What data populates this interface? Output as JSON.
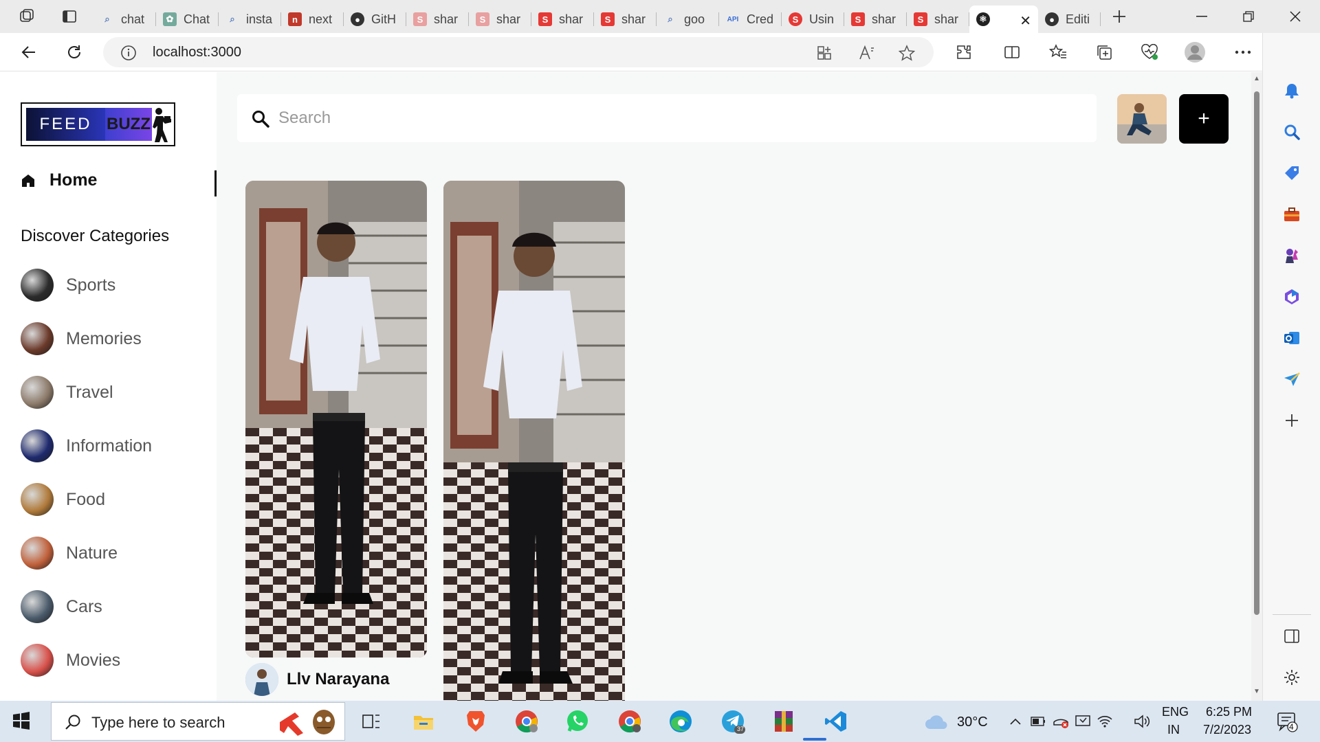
{
  "browser": {
    "tabs": [
      {
        "title": "chat",
        "favicon": "search-favicon",
        "color": "#5b7fbf"
      },
      {
        "title": "Chat",
        "favicon": "openai-favicon",
        "color": "#74aa9c"
      },
      {
        "title": "insta",
        "favicon": "search-favicon",
        "color": "#5b7fbf"
      },
      {
        "title": "next",
        "favicon": "n-favicon",
        "color": "#c0392b"
      },
      {
        "title": "GitH",
        "favicon": "github-favicon",
        "color": "#333333"
      },
      {
        "title": "shar",
        "favicon": "s-favicon",
        "color": "#e8a0a0"
      },
      {
        "title": "shar",
        "favicon": "s-favicon",
        "color": "#e8a0a0"
      },
      {
        "title": "shar",
        "favicon": "s-favicon",
        "color": "#e53935"
      },
      {
        "title": "shar",
        "favicon": "s-favicon",
        "color": "#e53935"
      },
      {
        "title": "goo",
        "favicon": "search-favicon",
        "color": "#5b7fbf"
      },
      {
        "title": "Cred",
        "favicon": "api-favicon",
        "color": "#3b6fd6"
      },
      {
        "title": "Usin",
        "favicon": "s-circle-favicon",
        "color": "#e53935"
      },
      {
        "title": "shar",
        "favicon": "s-favicon",
        "color": "#e53935"
      },
      {
        "title": "shar",
        "favicon": "s-favicon",
        "color": "#e53935"
      },
      {
        "title": "",
        "favicon": "react-favicon",
        "color": "#222222",
        "active": true
      },
      {
        "title": "Editi",
        "favicon": "github-favicon",
        "color": "#333333"
      }
    ],
    "url": "localhost:3000"
  },
  "sidebar": {
    "logo_left": "FEED",
    "logo_right": "BUZZ",
    "home_label": "Home",
    "discover_heading": "Discover Categories",
    "categories": [
      {
        "label": "Sports",
        "color": "#2b2b2b"
      },
      {
        "label": "Memories",
        "color": "#6b3a2a"
      },
      {
        "label": "Travel",
        "color": "#8c7a6a"
      },
      {
        "label": "Information",
        "color": "#1e2a6e"
      },
      {
        "label": "Food",
        "color": "#b07a3a"
      },
      {
        "label": "Nature",
        "color": "#c0603a"
      },
      {
        "label": "Cars",
        "color": "#4a5a6a"
      },
      {
        "label": "Movies",
        "color": "#d8504a"
      }
    ]
  },
  "main": {
    "search_placeholder": "Search",
    "create_label": "+",
    "pins": [
      {
        "author": "Llv Narayana"
      },
      {
        "author": ""
      }
    ]
  },
  "taskbar": {
    "search_placeholder": "Type here to search",
    "weather": "30°C",
    "lang_top": "ENG",
    "lang_bottom": "IN",
    "time": "6:25 PM",
    "date": "7/2/2023",
    "notification_count": "4",
    "telegram_badge": "37"
  }
}
